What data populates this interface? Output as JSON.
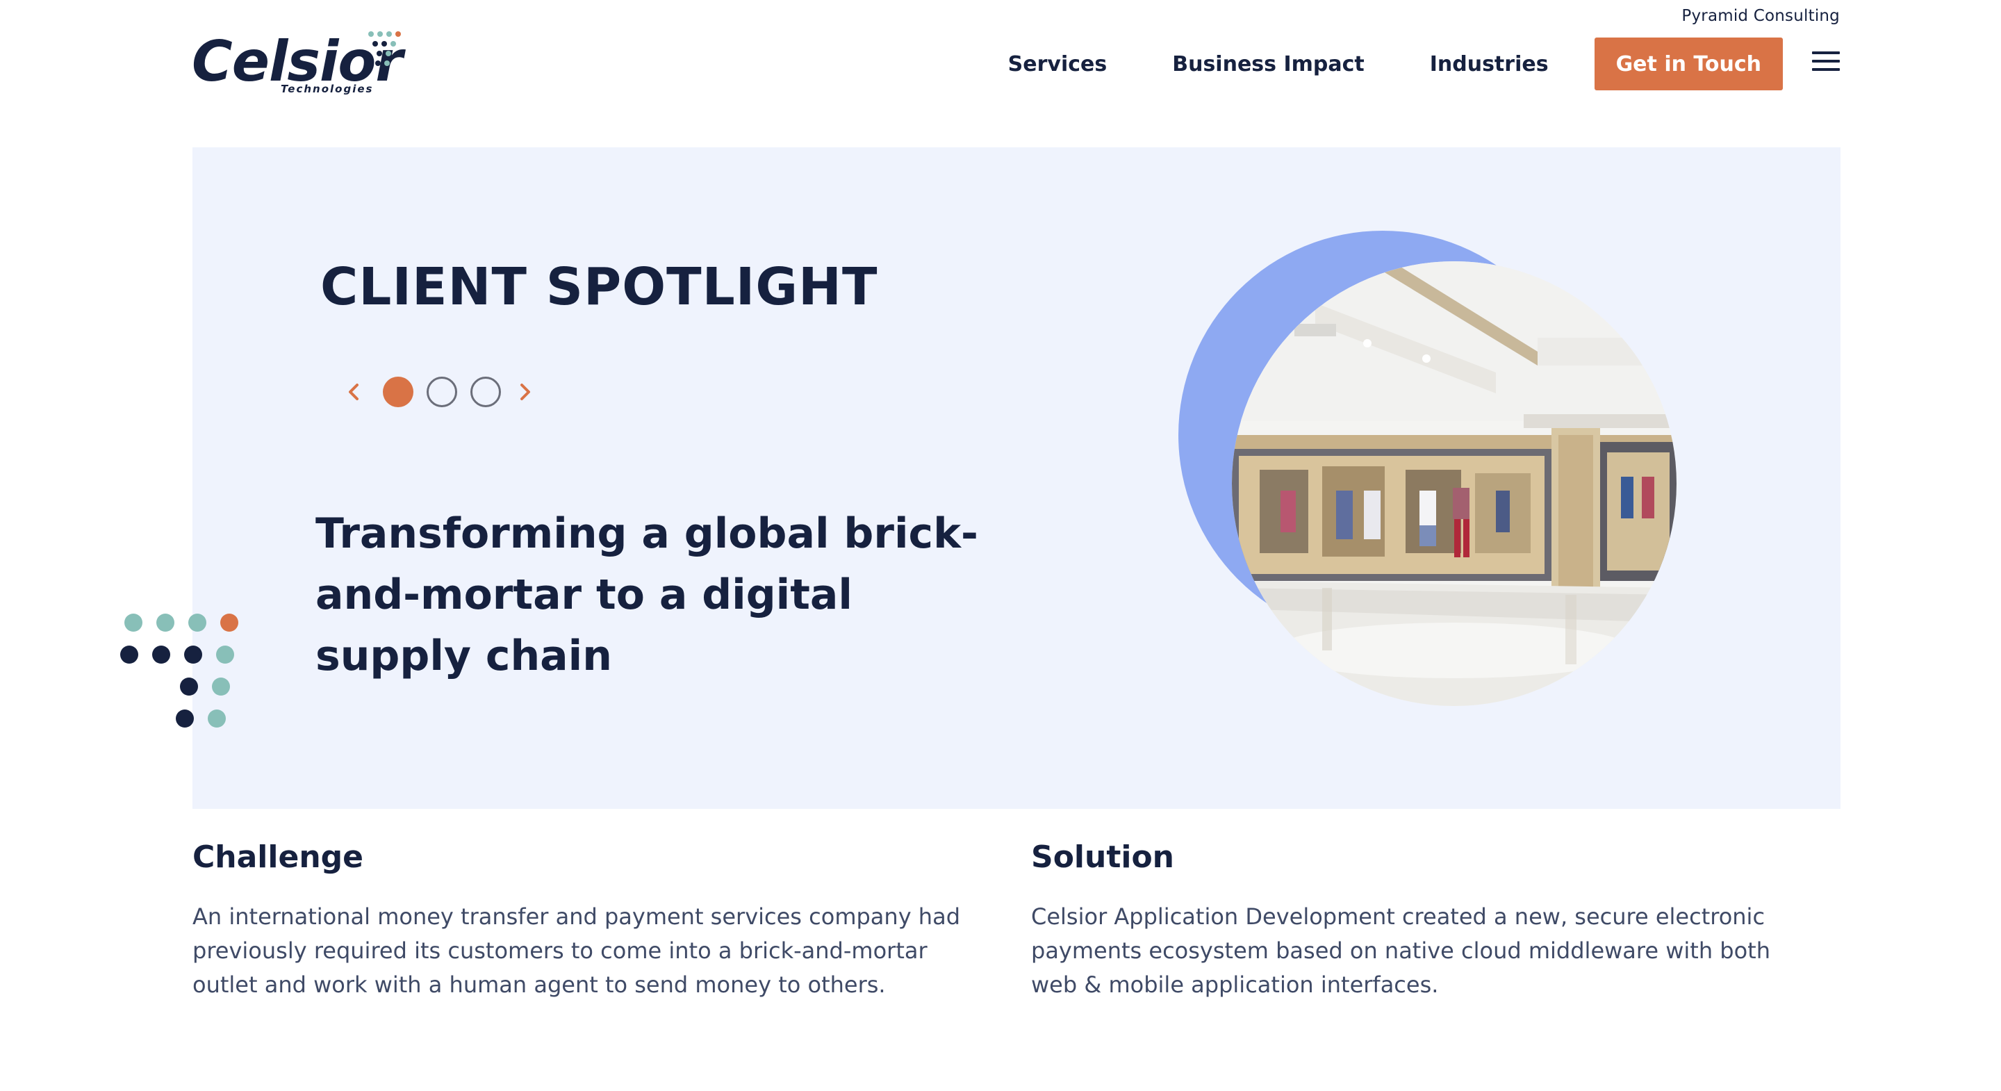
{
  "header": {
    "top_link": "Pyramid Consulting",
    "logo": {
      "wordmark": "Celsior",
      "subtitle": "Technologies"
    },
    "nav": [
      {
        "label": "Services"
      },
      {
        "label": "Business Impact"
      },
      {
        "label": "Industries"
      }
    ],
    "cta_label": "Get in Touch",
    "menu_icon": "hamburger-menu-icon"
  },
  "spotlight": {
    "title": "CLIENT SPOTLIGHT",
    "carousel": {
      "slides_count": 3,
      "active_index": 0,
      "prev_icon": "chevron-left-icon",
      "next_icon": "chevron-right-icon"
    },
    "headline": "Transforming a global brick-and-mortar to a digital supply chain",
    "image_subject": "retail-store-interior-photo"
  },
  "challenge": {
    "heading": "Challenge",
    "body": "An international money transfer and payment services company had previously required its customers to come into a brick-and-mortar outlet and work with a human agent to send money to others."
  },
  "solution": {
    "heading": "Solution",
    "body": "Celsior Application Development created a new, secure electronic payments ecosystem based on native cloud middleware with both web & mobile application interfaces."
  },
  "colors": {
    "navy": "#16213f",
    "accent_orange": "#d97346",
    "panel_bg": "#eff3fd",
    "circle_blue": "#8ea9f2",
    "teal": "#88bfb8"
  }
}
